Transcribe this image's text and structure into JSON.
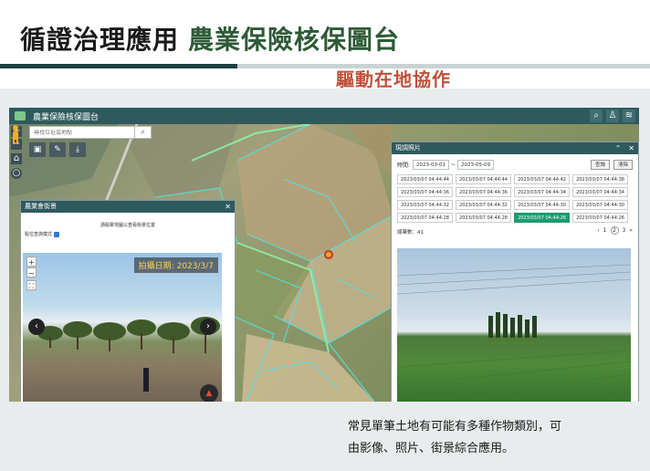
{
  "slide": {
    "title_part1": "循證治理應用",
    "title_part2": "農業保險核保圖台",
    "subtitle": "驅動在地協作",
    "caption": "常見單筆土地有可能有多種作物類別，可\n由影像、照片、街景綜合應用。"
  },
  "app": {
    "title": "農業保險核保圖台",
    "search_placeholder": "尋找位址或地點",
    "streetview": {
      "title": "農業會街景",
      "hint": "請點擊地圖以查看街景位置",
      "position_mode": "點位查詢模式",
      "photo_date": "拍攝日期: 2023/3/7"
    },
    "photos": {
      "title": "現調照片",
      "time_label": "時間:",
      "date_from": "2023-03-01",
      "date_sep": "~",
      "date_to": "2023-05-09",
      "query_label": "查詢",
      "clear_label": "清除",
      "items": [
        "2023/03/07 04:44:44",
        "2023/03/07 04:44:44",
        "2023/03/07 04:44:42",
        "2023/03/07 04:44:38",
        "2023/03/07 04:44:36",
        "2023/03/07 04:44:36",
        "2023/03/07 04:44:34",
        "2023/03/07 04:44:34",
        "2023/03/07 04:44:32",
        "2023/03/07 04:44:32",
        "2023/03/07 04:44:30",
        "2023/03/07 04:44:30",
        "2023/03/07 04:44:28",
        "2023/03/07 04:44:28",
        "2023/03/07 04:44:26",
        "2023/03/07 04:44:26"
      ],
      "active_index": 14,
      "total_label": "總筆數：41",
      "pages": [
        "1",
        "2",
        "3"
      ],
      "current_page": "2",
      "prev": "‹",
      "next": "›",
      "last": "»"
    }
  },
  "colors": {
    "header_teal": "#2f5a5d",
    "active_green": "#1e9a6e",
    "title_green": "#2e5a36",
    "subtitle_red": "#c0503a",
    "date_yellow": "#ffd24a"
  },
  "icons": [
    "zoom-in-icon",
    "zoom-out-icon",
    "home-icon",
    "locate-icon",
    "search-icon",
    "camera-icon",
    "pencil-icon",
    "pin-icon",
    "street-view-icon",
    "person-icon",
    "layers-icon",
    "close-icon",
    "collapse-icon",
    "compass-icon"
  ]
}
